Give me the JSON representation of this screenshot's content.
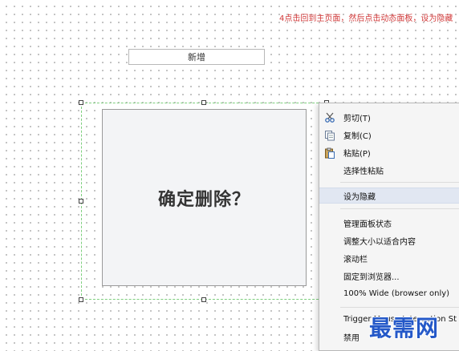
{
  "annotation": "4点击回到主页面，然后点击动态面板，设为隐藏",
  "add_button": {
    "label": "新增"
  },
  "dialog": {
    "text": "确定删除？"
  },
  "context_menu": {
    "items": [
      {
        "label": "剪切(T)",
        "icon": "scissors-icon"
      },
      {
        "label": "复制(C)",
        "icon": "copy-icon"
      },
      {
        "label": "粘贴(P)",
        "icon": "paste-icon"
      },
      {
        "label": "选择性粘贴"
      },
      {
        "label": "设为隐藏",
        "highlighted": true
      },
      {
        "label": "管理面板状态"
      },
      {
        "label": "调整大小以适合内容"
      },
      {
        "label": "滚动栏"
      },
      {
        "label": "固定到浏览器..."
      },
      {
        "label": "100% Wide (browser only)"
      },
      {
        "label": "Trigger Mouse Interaction St"
      },
      {
        "label": "禁用"
      }
    ]
  },
  "watermark": "最需网",
  "colors": {
    "annotation": "#d23a3a",
    "selection_border": "#7dcf7d",
    "menu_highlight": "#e1e7f2",
    "watermark": "#2458c8"
  }
}
